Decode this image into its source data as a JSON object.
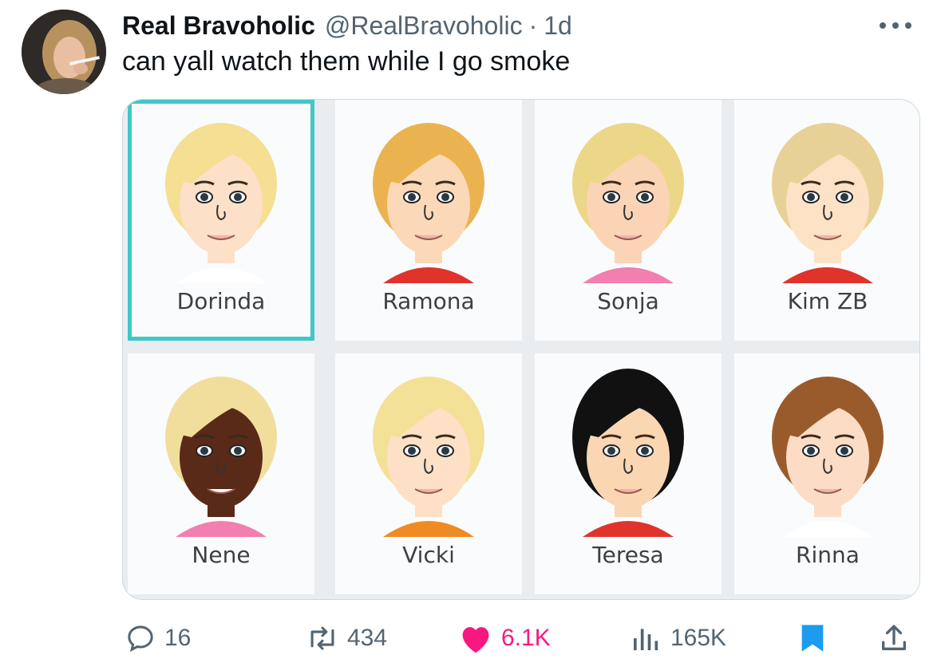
{
  "tweet": {
    "author_name": "Real Bravoholic",
    "handle": "@RealBravoholic",
    "separator": "·",
    "time": "1d",
    "text": "can yall watch them while I go smoke",
    "more_icon": "ellipsis-icon"
  },
  "media": {
    "tiles": [
      {
        "label": "Dorinda",
        "selected": true,
        "hair": "#f4df92",
        "skin": "#fde0c8",
        "shirt": "#ffffff"
      },
      {
        "label": "Ramona",
        "selected": false,
        "hair": "#ebb34f",
        "skin": "#fbd8b8",
        "shirt": "#e0332c"
      },
      {
        "label": "Sonja",
        "selected": false,
        "hair": "#ecd688",
        "skin": "#fbd4b6",
        "shirt": "#f27fb0"
      },
      {
        "label": "Kim ZB",
        "selected": false,
        "hair": "#e7d196",
        "skin": "#fde2c6",
        "shirt": "#e0332c"
      },
      {
        "label": "Nene",
        "selected": false,
        "hair": "#f1de9d",
        "skin": "#5a2a18",
        "shirt": "#f27fb0"
      },
      {
        "label": "Vicki",
        "selected": false,
        "hair": "#f3e197",
        "skin": "#fde0c6",
        "shirt": "#f08a22"
      },
      {
        "label": "Teresa",
        "selected": false,
        "hair": "#111111",
        "skin": "#fbd6b3",
        "shirt": "#e0332c"
      },
      {
        "label": "Rinna",
        "selected": false,
        "hair": "#9a5b2c",
        "skin": "#fcdcc4",
        "shirt": "#ffffff"
      }
    ],
    "selection_color": "#3ec8c6"
  },
  "actions": {
    "reply_count": "16",
    "repost_count": "434",
    "like_count": "6.1K",
    "views_count": "165K",
    "reply_icon": "reply-icon",
    "repost_icon": "repost-icon",
    "like_icon": "heart-icon",
    "views_icon": "analytics-icon",
    "bookmark_icon": "bookmark-icon",
    "share_icon": "share-icon",
    "like_color": "#f91880",
    "bookmark_color": "#1d9bf0"
  }
}
